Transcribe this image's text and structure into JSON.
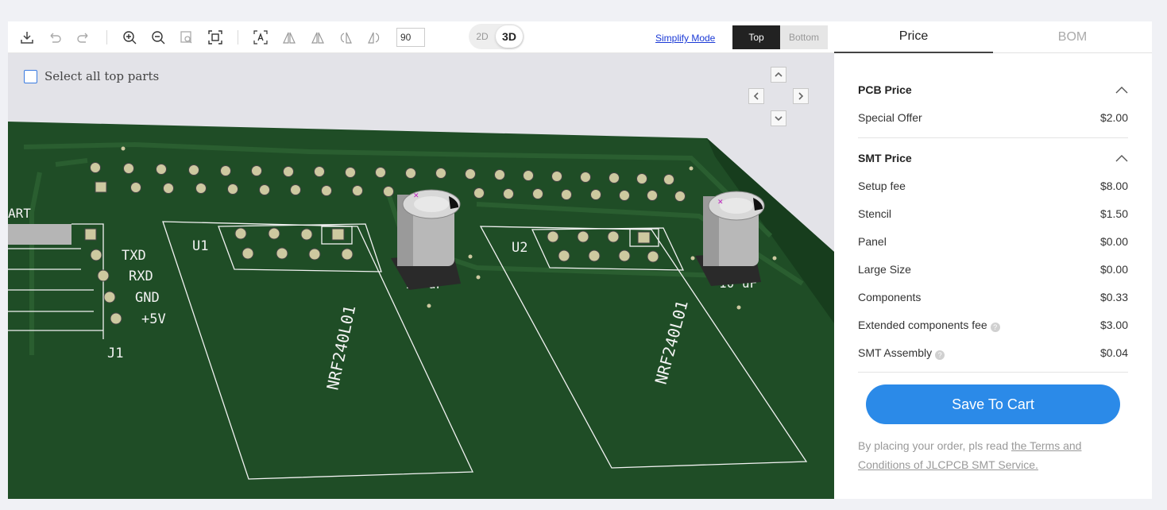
{
  "toolbar": {
    "icons": [
      "download-icon",
      "undo-icon",
      "redo-icon",
      "zoom-in-icon",
      "zoom-out-icon",
      "zoom-area-icon",
      "fit-icon",
      "text-tool-icon",
      "flip-left-icon",
      "flip-right-icon",
      "rotate-left-icon",
      "rotate-right-icon"
    ],
    "angle_value": "90",
    "dim_2d": "2D",
    "dim_3d": "3D",
    "simplify_mode": "Simplify Mode",
    "side_top": "Top",
    "side_bottom": "Bottom"
  },
  "viewer": {
    "select_all_label": "Select all top parts",
    "silkscreen": {
      "u1": "U1",
      "u2": "U2",
      "j1": "J1",
      "txd": "TXD",
      "rxd": "RXD",
      "gnd": "GND",
      "plus5v": "+5V",
      "art": "ART",
      "module1": "NRF240L01",
      "module2": "NRF240L01",
      "cap1": "10 uF",
      "cap2": "10 uF"
    },
    "colors": {
      "board": "#1f4d26",
      "silk": "#f2f2f2",
      "pad": "#cdc9a0",
      "background": "#e3e3e8"
    }
  },
  "panel": {
    "tabs": [
      "Price",
      "BOM"
    ],
    "pcb_section": "PCB Price",
    "pcb_rows": [
      {
        "label": "Special Offer",
        "value": "$2.00"
      }
    ],
    "smt_section": "SMT Price",
    "smt_rows": [
      {
        "label": "Setup fee",
        "value": "$8.00"
      },
      {
        "label": "Stencil",
        "value": "$1.50"
      },
      {
        "label": "Panel",
        "value": "$0.00"
      },
      {
        "label": "Large Size",
        "value": "$0.00"
      },
      {
        "label": "Components",
        "value": "$0.33"
      },
      {
        "label": "Extended components fee",
        "value": "$3.00"
      },
      {
        "label": "SMT Assembly",
        "value": "$0.04"
      }
    ],
    "cart_button": "Save To Cart",
    "terms_prefix": "By placing your order, pls read ",
    "terms_link": "the Terms and Conditions of JLCPCB SMT Service.",
    "accent": "#2b8ae8"
  }
}
